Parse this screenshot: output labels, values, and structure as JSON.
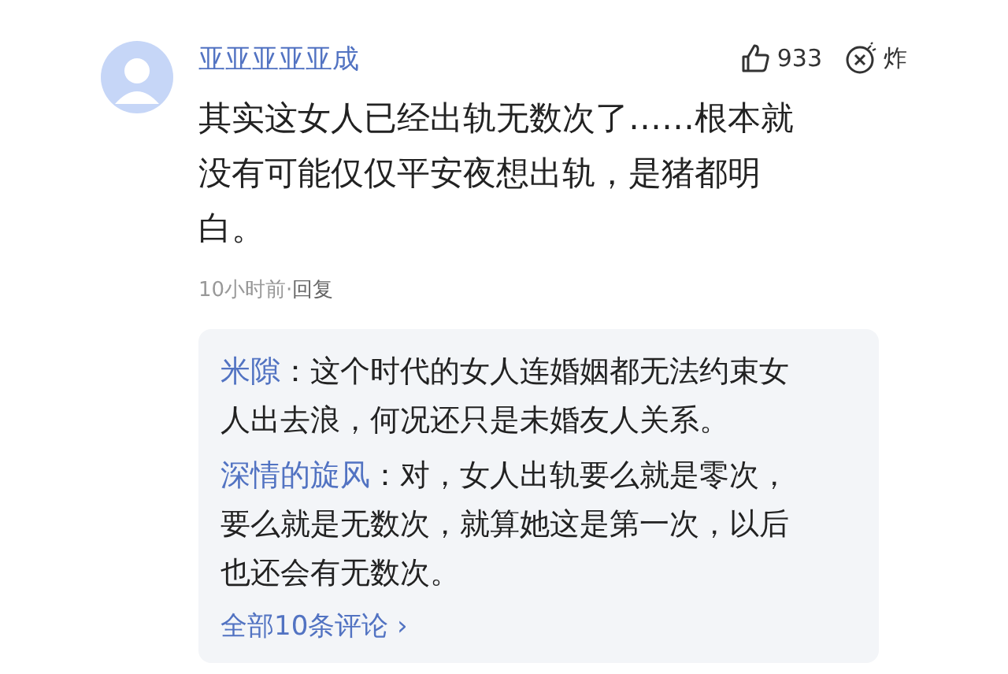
{
  "comment": {
    "author": "亚亚亚亚亚成",
    "likes": "933",
    "bomb_label": "炸",
    "text": "其实这女人已经出轨无数次了……根本就没有可能仅仅平安夜想出轨，是猪都明白。",
    "time": "10小时前",
    "separator": "·",
    "reply_link": "回复",
    "replies": [
      {
        "author": "米隙",
        "text": "：这个时代的女人连婚姻都无法约束女人出去浪，何况还只是未婚友人关系。"
      },
      {
        "author": "深情的旋风",
        "text": "：对，女人出轨要么就是零次，要么就是无数次，就算她这是第一次，以后也还会有无数次。"
      }
    ],
    "all_replies": "全部10条评论",
    "all_replies_arrow": "›"
  }
}
